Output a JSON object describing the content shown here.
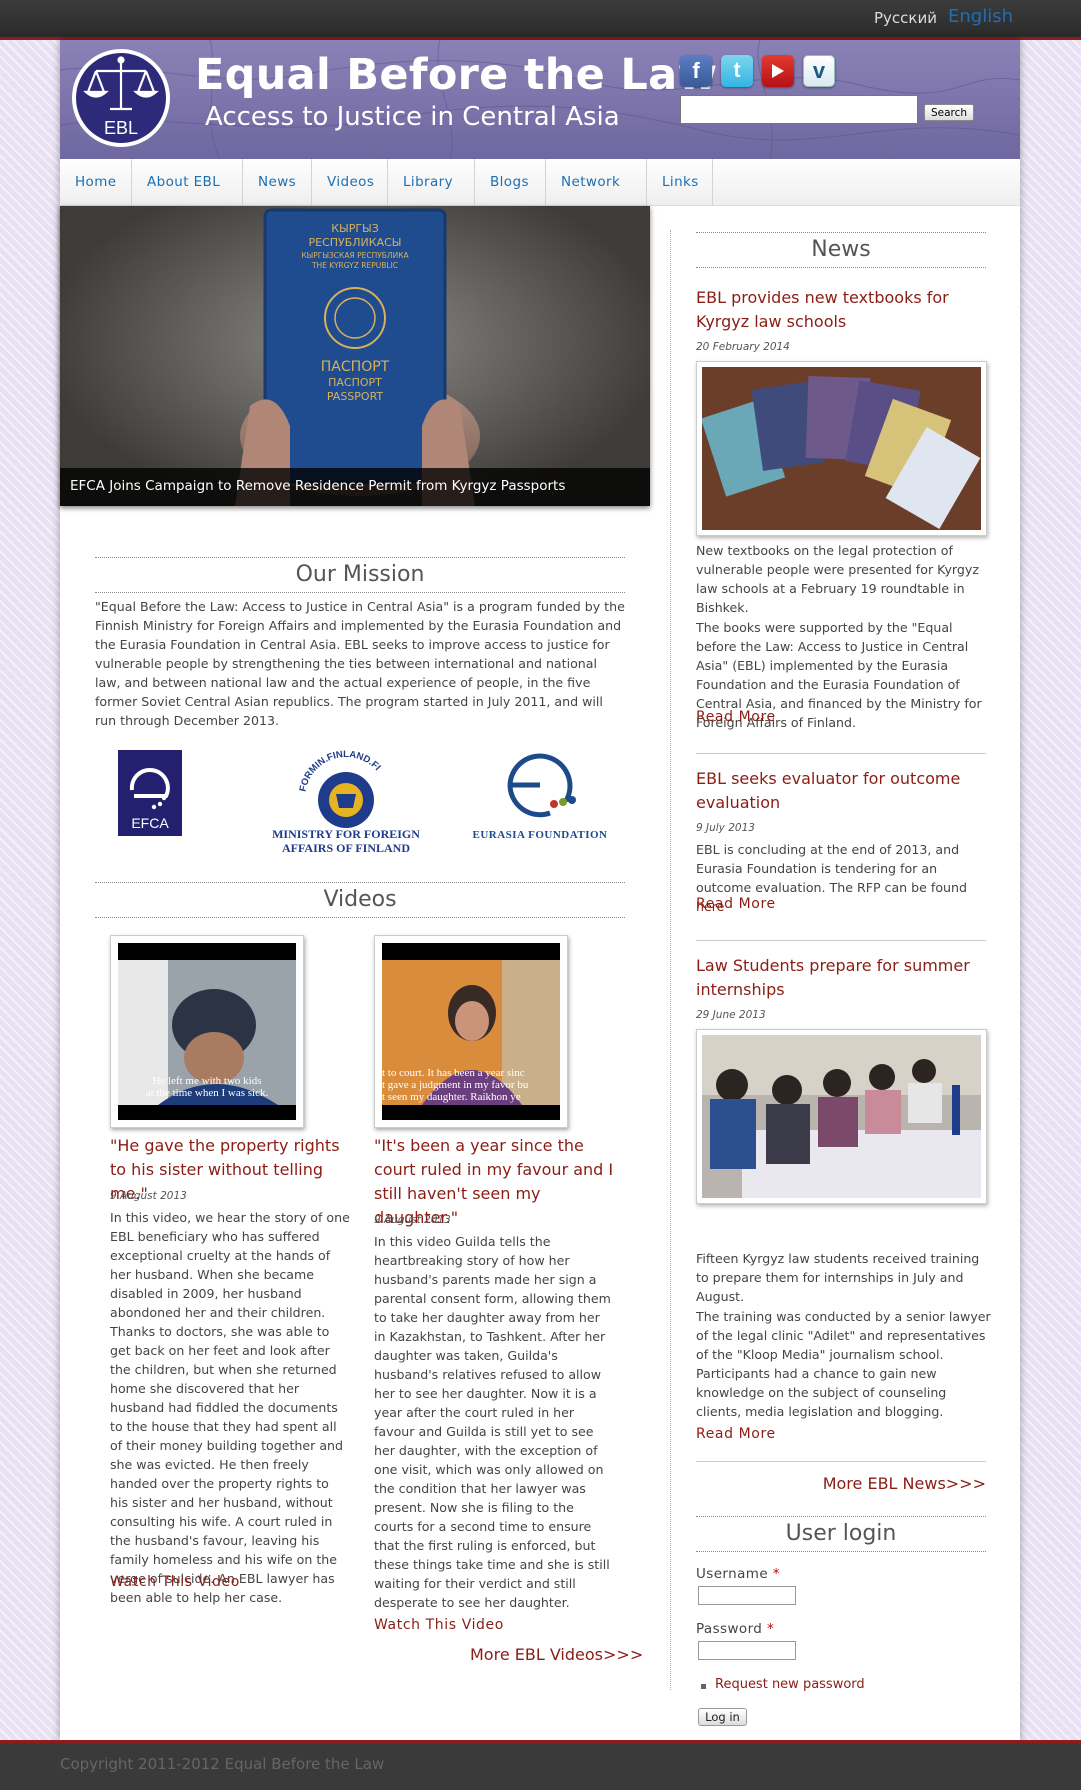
{
  "topbar": {
    "lang_ru": "Русский",
    "lang_en": "English"
  },
  "header": {
    "logo_text": "EBL",
    "title": "Equal Before the Law",
    "subtitle": "Access to Justice in Central Asia",
    "search_button": "Search",
    "search_placeholder": ""
  },
  "nav": {
    "items": [
      "Home",
      "About EBL",
      "News",
      "Videos",
      "Library",
      "Blogs",
      "Network",
      "Links"
    ]
  },
  "hero": {
    "caption": "EFCA Joins Campaign to Remove Residence Permit from Kyrgyz Passports",
    "passport_lines": [
      "КЫРГЫЗ",
      "РЕСПУБЛИКАСЫ",
      "КЫРГЫЗСКАЯ РЕСПУБЛИКА",
      "THE KYRGYZ REPUBLIC",
      "ПАСПОРТ",
      "ПАСПОРТ",
      "PASSPORT"
    ]
  },
  "mission": {
    "heading": "Our Mission",
    "text": "\"Equal Before the Law: Access to Justice in Central Asia\" is a program funded by the Finnish Ministry for Foreign Affairs and implemented by the Eurasia Foundation and the Eurasia Foundation in Central Asia. EBL seeks to improve access to justice for vulnerable people by strengthening the ties between international and national law, and between national law and the actual experience of people, in the five former Soviet Central Asian republics. The program started in July 2011, and will run through December 2013.",
    "partners": {
      "efca": "EFCA",
      "finland_arc": "FORMIN.FINLAND.FI",
      "finland_line1": "MINISTRY FOR FOREIGN",
      "finland_line2": "AFFAIRS OF FINLAND",
      "eurasia": "EURASIA FOUNDATION"
    }
  },
  "videos": {
    "heading": "Videos",
    "items": [
      {
        "subtitle_line1": "He left me with two kids",
        "subtitle_line2": "at the time when I was sick.",
        "title": "\"He gave the property rights to his sister without telling me.\"",
        "date": "9 August 2013",
        "text": "In this video, we hear the story of one EBL beneficiary who has suffered exceptional cruelty at the hands of her husband. When she became disabled in 2009, her husband abondoned her and their children. Thanks to doctors, she was able to get back on her feet and look after the children, but when she returned home she discovered that her husband had fiddled the documents to the house that they had spent all of their money building together and she was evicted. He then freely handed over the property rights to his sister and her husband, without consulting his wife. A court ruled in the husband's favour, leaving his family homeless and his wife on the verge of suicide. An EBL lawyer has been able to help her case.",
        "link": "Watch This Video"
      },
      {
        "subtitle_line1": "t to court. It has been a year sinc",
        "subtitle_line2": "t gave a judgment in my favor bu",
        "subtitle_line3": "t seen my daughter. Raikhon ye",
        "title": "\"It's been a year since the court ruled in my favour and I still haven't seen my daughter.\"",
        "date": "9 August 2013",
        "text": "In this video Guilda tells the heartbreaking story of how her husband's parents made her sign a parental consent form, allowing them to take her daughter away from her in Kazakhstan, to Tashkent. After her daughter was taken, Guilda's husband's relatives refused to allow her to see her daughter. Now it is a year after the court ruled in her favour and Guilda is still yet to see her daughter, with the exception of one visit, which was only allowed on the condition that her lawyer was present. Now she is filing to the courts for a second time to ensure that the first ruling is enforced, but these things take time and she is still waiting for their verdict and still desperate to see her daughter.",
        "link": "Watch This Video"
      }
    ],
    "more": "More EBL Videos>>>"
  },
  "news": {
    "heading": "News",
    "items": [
      {
        "title": "EBL provides new textbooks for Kyrgyz law schools",
        "date": "20 February 2014",
        "para1": "New textbooks on the legal protection of vulnerable people were presented for Kyrgyz law schools at a February 19 roundtable in Bishkek.",
        "para2": "The books were supported by the \"Equal before the Law: Access to Justice in Central Asia\" (EBL) implemented by the Eurasia Foundation and the Eurasia Foundation of Central Asia, and financed by the Ministry for Foreign Affairs of Finland.",
        "read_more": "Read More"
      },
      {
        "title": "EBL seeks evaluator for outcome evaluation",
        "date": "9 July 2013",
        "para1": "EBL is concluding at the end of 2013, and Eurasia Foundation is tendering for an outcome evaluation. The RFP can be found ",
        "here": "here",
        "read_more": "Read More"
      },
      {
        "title": "Law Students prepare for summer internships",
        "date": "29 June 2013",
        "para1": "Fifteen Kyrgyz law students received training to prepare them for internships in July and August.",
        "para2": "The training was conducted by a senior lawyer of the legal clinic \"Adilet\" and representatives of the \"Kloop Media\" journalism school.  Participants had a chance to gain new knowledge on the subject of counseling clients, media legislation and blogging.",
        "read_more": "Read More"
      }
    ],
    "more": "More EBL News>>>"
  },
  "login": {
    "heading": "User login",
    "username_label": "Username",
    "password_label": "Password",
    "required_mark": "*",
    "request_password": "Request new password",
    "submit": "Log in"
  },
  "footer": {
    "copyright": "Copyright 2011-2012 Equal Before the Law"
  },
  "colors": {
    "accent_red": "#8b1d14",
    "nav_blue": "#1b6fb3",
    "header_purple": "#776fa6",
    "background": "#e7e1f3"
  },
  "icons": [
    "facebook-icon",
    "twitter-icon",
    "youtube-icon",
    "vimeo-icon",
    "scales-icon"
  ]
}
